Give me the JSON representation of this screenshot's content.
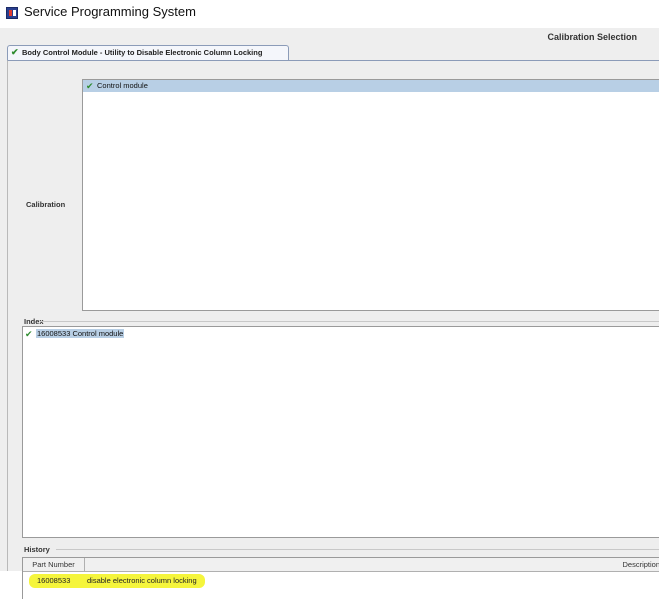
{
  "window": {
    "title": "Service Programming System",
    "icon": "app-icon"
  },
  "header": {
    "calibration_selection": "Calibration Selection"
  },
  "tab": {
    "label": "Body Control Module - Utility to Disable Electronic Column Locking",
    "icon": "check-icon"
  },
  "calibration": {
    "label": "Calibration",
    "items": [
      {
        "label": "Control module",
        "selected": true,
        "icon": "check-icon"
      }
    ]
  },
  "index": {
    "label": "Index",
    "items": [
      {
        "label": "16008533 Control module",
        "selected": true,
        "icon": "check-icon"
      }
    ]
  },
  "history": {
    "label": "History",
    "columns": [
      "Part Number",
      "Description"
    ],
    "rows": [
      {
        "part_number": "16008533",
        "description": "disable electronic column locking"
      }
    ]
  },
  "colors": {
    "selection": "#b8cfe5",
    "highlight": "#f5f53c",
    "check": "#2e8b2e"
  }
}
